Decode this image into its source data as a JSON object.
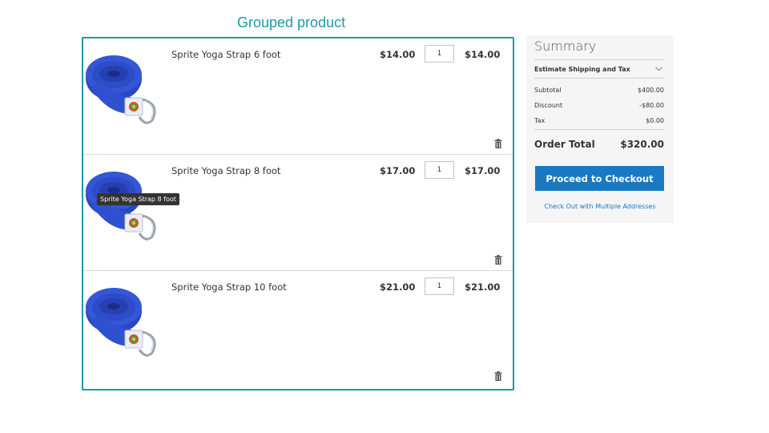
{
  "caption": "Grouped product",
  "cart": {
    "items": [
      {
        "name": "Sprite Yoga Strap 6 foot",
        "price": "$14.00",
        "qty": "1",
        "subtotal": "$14.00"
      },
      {
        "name": "Sprite Yoga Strap 8 foot",
        "price": "$17.00",
        "qty": "1",
        "subtotal": "$17.00"
      },
      {
        "name": "Sprite Yoga Strap 10 foot",
        "price": "$21.00",
        "qty": "1",
        "subtotal": "$21.00"
      }
    ],
    "tooltip": "Sprite Yoga Strap 8 foot"
  },
  "summary": {
    "title": "Summary",
    "estimate_label": "Estimate Shipping and Tax",
    "subtotal_label": "Subtotal",
    "subtotal_value": "$400.00",
    "discount_label": "Discount",
    "discount_value": "-$80.00",
    "tax_label": "Tax",
    "tax_value": "$0.00",
    "total_label": "Order Total",
    "total_value": "$320.00",
    "checkout_label": "Proceed to Checkout",
    "multi_label": "Check Out with Multiple Addresses"
  },
  "icons": {
    "delete": "trash-icon",
    "expand": "chevron-down-icon"
  },
  "colors": {
    "accent": "#1a9aa6",
    "button": "#1979c3",
    "strap": "#2f4fc4"
  }
}
